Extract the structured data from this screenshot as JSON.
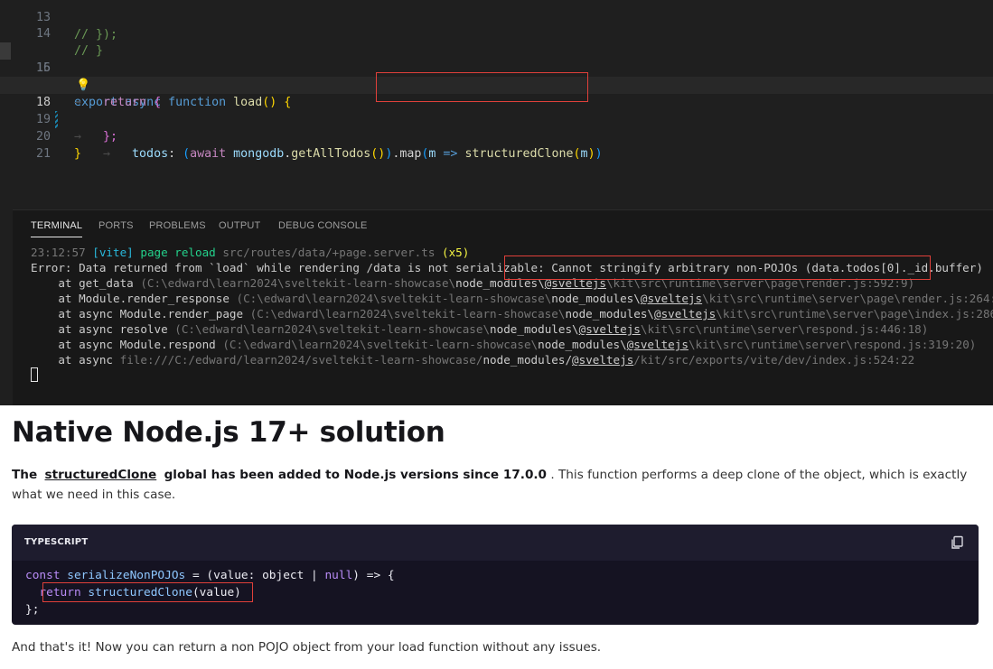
{
  "editor": {
    "lines": [
      {
        "num": "13",
        "text": "// });"
      },
      {
        "num": "14",
        "text": "// }"
      },
      {
        "num": "15",
        "text": ""
      },
      {
        "num": "16",
        "kw_export": "export",
        "kw_async": "async",
        "kw_function": "function",
        "fn_name": "load",
        "rest": "() {"
      },
      {
        "num": "17",
        "kw_return": "return",
        "rest": "{"
      },
      {
        "num": "18",
        "prop": "todos",
        "colon": ":",
        "open_paren": "(",
        "kw_await": "await",
        "obj": "mongodb",
        "method": "getAllTodos",
        "call": "()",
        "close_paren": ")",
        "map": ".map",
        "map_open": "(",
        "param": "m",
        "arrow": "=>",
        "fn2": "structuredClone",
        "fn2_open": "(",
        "arg": "m",
        "fn2_close": ")",
        "map_close": ")"
      },
      {
        "num": "19",
        "text": "};"
      },
      {
        "num": "20",
        "text": "}"
      },
      {
        "num": "21",
        "text": ""
      }
    ]
  },
  "panel": {
    "tabs": [
      "TERMINAL",
      "PORTS",
      "PROBLEMS",
      "OUTPUT",
      "DEBUG CONSOLE"
    ],
    "terminal": {
      "line1": {
        "time": "23:12:57",
        "tag": "[vite]",
        "msg": "page reload",
        "path": "src/routes/data/+page.server.ts",
        "count": "(x5)"
      },
      "error_prefix": "Error: Data returned from `load` while rendering /data is not serializable:",
      "error_detail": "Cannot stringify arbitrary non-POJOs (data.todos[0]._id.buffer)",
      "stack": [
        {
          "at": "at get_data",
          "base": "(C:\\edward\\learn2024\\sveltekit-learn-showcase\\",
          "mod": "node_modules\\",
          "pkg": "@sveltejs",
          "tail": "\\kit\\src\\runtime\\server\\page\\render.js:592:9)"
        },
        {
          "at": "at Module.render_response",
          "base": "(C:\\edward\\learn2024\\sveltekit-learn-showcase\\",
          "mod": "node_modules\\",
          "pkg": "@sveltejs",
          "tail": "\\kit\\src\\runtime\\server\\page\\render.js:264:27)"
        },
        {
          "at": "at async Module.render_page",
          "base": "(C:\\edward\\learn2024\\sveltekit-learn-showcase\\",
          "mod": "node_modules\\",
          "pkg": "@sveltejs",
          "tail": "\\kit\\src\\runtime\\server\\page\\index.js:286:10)"
        },
        {
          "at": "at async resolve",
          "base": "(C:\\edward\\learn2024\\sveltekit-learn-showcase\\",
          "mod": "node_modules\\",
          "pkg": "@sveltejs",
          "tail": "\\kit\\src\\runtime\\server\\respond.js:446:18)"
        },
        {
          "at": "at async Module.respond",
          "base": "(C:\\edward\\learn2024\\sveltekit-learn-showcase\\",
          "mod": "node_modules\\",
          "pkg": "@sveltejs",
          "tail": "\\kit\\src\\runtime\\server\\respond.js:319:20)"
        },
        {
          "at": "at async",
          "base": "file:///C:/edward/learn2024/sveltekit-learn-showcase/",
          "mod": "node_modules/",
          "pkg": "@sveltejs",
          "tail": "/kit/src/exports/vite/dev/index.js:524:22"
        }
      ]
    }
  },
  "article": {
    "heading": "Native Node.js 17+ solution",
    "para_lead": "The",
    "para_code": "structuredClone",
    "para_bold": "global has been added to Node.js versions since 17.0.0",
    "para_rest": ". This function performs a deep clone of the object, which is exactly what we need in this case.",
    "code_lang": "TYPESCRIPT",
    "code": {
      "l1": {
        "kw": "const",
        "name": "serializeNonPOJOs",
        "eq": "=",
        "open": "(",
        "param": "value",
        "colon": ":",
        "type": "object",
        "pipe": "|",
        "nul": "null",
        "close": ")",
        "arrow": "=>",
        "brace": "{"
      },
      "l2": {
        "kw": "return",
        "fn": "structuredClone",
        "arg": "(value)"
      },
      "l3": "};"
    },
    "closing": "And that's it! Now you can return a non POJO object from your load function without any issues."
  },
  "colors": {
    "highlight_box": "#e0403a",
    "editor_bg": "#1f1f1f",
    "panel_bg": "#181818",
    "code_card_bg": "#151322"
  }
}
